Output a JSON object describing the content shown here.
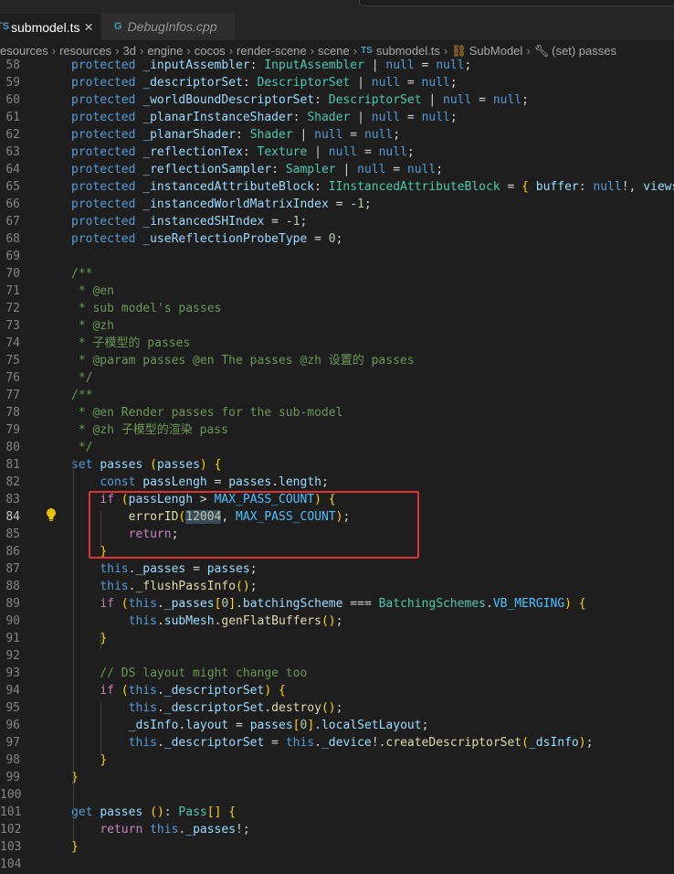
{
  "tabs": [
    {
      "icon": "typescript-file-icon",
      "label": "submodel.ts",
      "active": true
    },
    {
      "icon": "cpp-file-icon",
      "label": "DebugInfos.cpp",
      "active": false
    }
  ],
  "ts_badge": "TS",
  "breadcrumb": [
    "esources",
    "resources",
    "3d",
    "engine",
    "cocos",
    "render-scene",
    "scene",
    "submodel.ts",
    "SubModel",
    "(set) passes"
  ],
  "editor": {
    "current_line": 84,
    "highlight_box": {
      "from_line": 83,
      "to_line": 86,
      "color": "#e0322f"
    },
    "lines": [
      {
        "n": 58,
        "text": "protected _inputAssembler: InputAssembler | null = null;"
      },
      {
        "n": 59,
        "text": "protected _descriptorSet: DescriptorSet | null = null;"
      },
      {
        "n": 60,
        "text": "protected _worldBoundDescriptorSet: DescriptorSet | null = null;"
      },
      {
        "n": 61,
        "text": "protected _planarInstanceShader: Shader | null = null;"
      },
      {
        "n": 62,
        "text": "protected _planarShader: Shader | null = null;"
      },
      {
        "n": 63,
        "text": "protected _reflectionTex: Texture | null = null;"
      },
      {
        "n": 64,
        "text": "protected _reflectionSampler: Sampler | null = null;"
      },
      {
        "n": 65,
        "text": "protected _instancedAttributeBlock: IInstancedAttributeBlock = { buffer: null!, views:"
      },
      {
        "n": 66,
        "text": "protected _instancedWorldMatrixIndex = -1;"
      },
      {
        "n": 67,
        "text": "protected _instancedSHIndex = -1;"
      },
      {
        "n": 68,
        "text": "protected _useReflectionProbeType = 0;"
      },
      {
        "n": 69,
        "text": ""
      },
      {
        "n": 70,
        "text": "/**"
      },
      {
        "n": 71,
        "text": " * @en"
      },
      {
        "n": 72,
        "text": " * sub model's passes"
      },
      {
        "n": 73,
        "text": " * @zh"
      },
      {
        "n": 74,
        "text": " * 子模型的 passes"
      },
      {
        "n": 75,
        "text": " * @param passes @en The passes @zh 设置的 passes"
      },
      {
        "n": 76,
        "text": " */"
      },
      {
        "n": 77,
        "text": "/**"
      },
      {
        "n": 78,
        "text": " * @en Render passes for the sub-model"
      },
      {
        "n": 79,
        "text": " * @zh 子模型的渲染 pass"
      },
      {
        "n": 80,
        "text": " */"
      },
      {
        "n": 81,
        "text": "set passes (passes) {"
      },
      {
        "n": 82,
        "text": "    const passLengh = passes.length;"
      },
      {
        "n": 83,
        "text": "    if (passLengh > MAX_PASS_COUNT) {"
      },
      {
        "n": 84,
        "text": "        errorID(12004, MAX_PASS_COUNT);"
      },
      {
        "n": 85,
        "text": "        return;"
      },
      {
        "n": 86,
        "text": "    }"
      },
      {
        "n": 87,
        "text": "    this._passes = passes;"
      },
      {
        "n": 88,
        "text": "    this._flushPassInfo();"
      },
      {
        "n": 89,
        "text": "    if (this._passes[0].batchingScheme === BatchingSchemes.VB_MERGING) {"
      },
      {
        "n": 90,
        "text": "        this.subMesh.genFlatBuffers();"
      },
      {
        "n": 91,
        "text": "    }"
      },
      {
        "n": 92,
        "text": ""
      },
      {
        "n": 93,
        "text": "    // DS layout might change too"
      },
      {
        "n": 94,
        "text": "    if (this._descriptorSet) {"
      },
      {
        "n": 95,
        "text": "        this._descriptorSet.destroy();"
      },
      {
        "n": 96,
        "text": "        _dsInfo.layout = passes[0].localSetLayout;"
      },
      {
        "n": 97,
        "text": "        this._descriptorSet = this._device!.createDescriptorSet(_dsInfo);"
      },
      {
        "n": 98,
        "text": "    }"
      },
      {
        "n": 99,
        "text": "}"
      },
      {
        "n": 100,
        "text": ""
      },
      {
        "n": 101,
        "text": "get passes (): Pass[] {"
      },
      {
        "n": 102,
        "text": "    return this._passes!;"
      },
      {
        "n": 103,
        "text": "}"
      },
      {
        "n": 104,
        "text": ""
      }
    ]
  }
}
